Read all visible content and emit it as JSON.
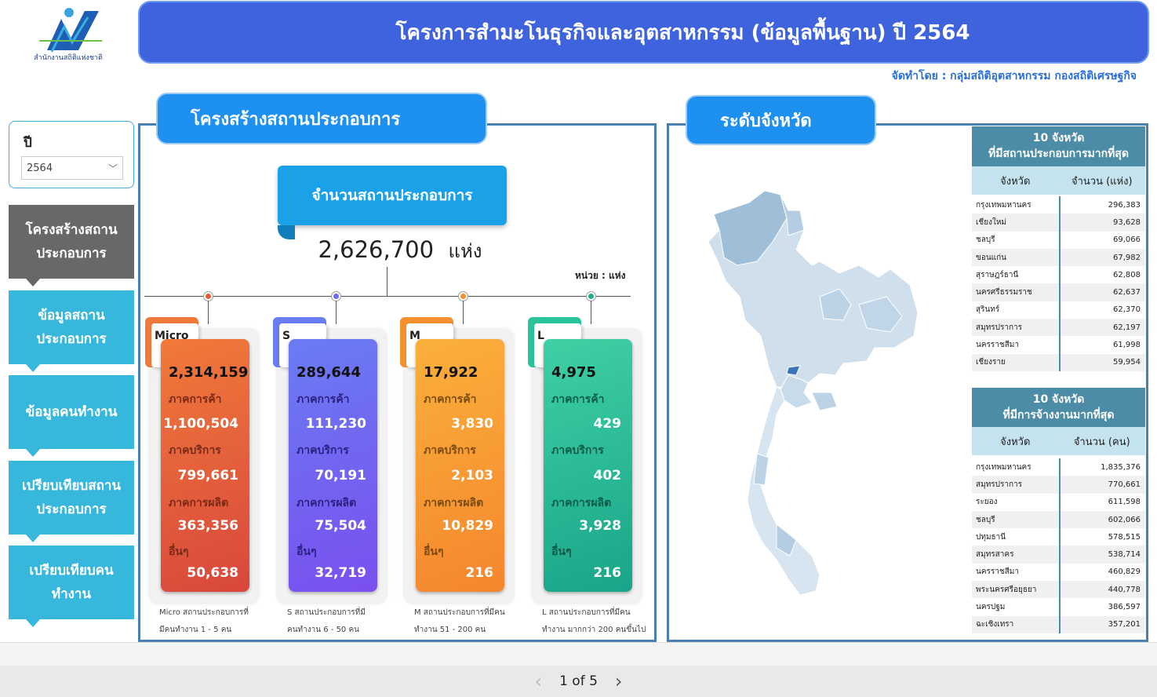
{
  "header": {
    "title": "โครงการสำมะโนธุรกิจและอุตสาหกรรม (ข้อมูลพื้นฐาน) ปี 2564",
    "credit": "จัดทำโดย : กลุ่มสถิติอุตสาหกรรม กองสถิติเศรษฐกิจ",
    "logo_text": "สำนักงานสถิติแห่งชาติ"
  },
  "filter": {
    "label": "ปี",
    "value": "2564"
  },
  "nav": [
    {
      "label": "โครงสร้างสถานประกอบการ",
      "active": true
    },
    {
      "label": "ข้อมูลสถานประกอบการ"
    },
    {
      "label": "ข้อมูลคนทำงาน"
    },
    {
      "label": "เปรียบเทียบสถานประกอบการ"
    },
    {
      "label": "เปรียบเทียบคนทำงาน"
    }
  ],
  "structure": {
    "title": "โครงสร้างสถานประกอบการ",
    "count_label": "จำนวนสถานประกอบการ",
    "total": "2,626,700",
    "total_unit": "แห่ง",
    "unit_note": "หน่วย : แห่ง",
    "sector_labels": {
      "trade": "ภาคการค้า",
      "service": "ภาคบริการ",
      "manufacturing": "ภาคการผลิต",
      "other": "อื่นๆ"
    },
    "cards": [
      {
        "tag": "Micro",
        "total": "2,314,159",
        "trade": "1,100,504",
        "service": "799,661",
        "manufacturing": "363,356",
        "other": "50,638",
        "note1": "Micro สถานประกอบการที่",
        "note2": "มีคนทำงาน 1 - 5 คน"
      },
      {
        "tag": "S",
        "total": "289,644",
        "trade": "111,230",
        "service": "70,191",
        "manufacturing": "75,504",
        "other": "32,719",
        "note1": "S สถานประกอบการที่มี",
        "note2": "คนทำงาน 6 - 50 คน"
      },
      {
        "tag": "M",
        "total": "17,922",
        "trade": "3,830",
        "service": "2,103",
        "manufacturing": "10,829",
        "other": "216",
        "note1": "M สถานประกอบการที่มีคน",
        "note2": "ทำงาน 51 - 200 คน"
      },
      {
        "tag": "L",
        "total": "4,975",
        "trade": "429",
        "service": "402",
        "manufacturing": "3,928",
        "other": "216",
        "note1": "L สถานประกอบการที่มีคน",
        "note2": "ทำงาน มากกว่า 200 คนขึ้นไป"
      }
    ]
  },
  "province": {
    "title": "ระดับจังหวัด",
    "top_establishments": {
      "title1": "10 จังหวัด",
      "title2": "ที่มีสถานประกอบการมากที่สุด",
      "col1": "จังหวัด",
      "col2": "จำนวน (แห่ง)",
      "rows": [
        [
          "กรุงเทพมหานคร",
          "296,383"
        ],
        [
          "เชียงใหม่",
          "93,628"
        ],
        [
          "ชลบุรี",
          "69,066"
        ],
        [
          "ขอนแก่น",
          "67,982"
        ],
        [
          "สุราษฎร์ธานี",
          "62,808"
        ],
        [
          "นครศรีธรรมราช",
          "62,637"
        ],
        [
          "สุรินทร์",
          "62,370"
        ],
        [
          "สมุทรปราการ",
          "62,197"
        ],
        [
          "นครราชสีมา",
          "61,998"
        ],
        [
          "เชียงราย",
          "59,954"
        ]
      ]
    },
    "top_employment": {
      "title1": "10 จังหวัด",
      "title2": "ที่มีการจ้างงานมากที่สุด",
      "col1": "จังหวัด",
      "col2": "จำนวน (คน)",
      "rows": [
        [
          "กรุงเทพมหานคร",
          "1,835,376"
        ],
        [
          "สมุทรปราการ",
          "770,661"
        ],
        [
          "ระยอง",
          "611,598"
        ],
        [
          "ชลบุรี",
          "602,066"
        ],
        [
          "ปทุมธานี",
          "578,515"
        ],
        [
          "สมุทรสาคร",
          "538,714"
        ],
        [
          "นครราชสีมา",
          "460,829"
        ],
        [
          "พระนครศรีอยุธยา",
          "440,778"
        ],
        [
          "นครปฐม",
          "386,597"
        ],
        [
          "ฉะเชิงเทรา",
          "357,201"
        ]
      ]
    }
  },
  "pager": {
    "label": "1 of 5"
  },
  "colors": {
    "micro": [
      "#f07a3a",
      "#d9473c"
    ],
    "s": [
      "#6a7cf2",
      "#7a4ff0"
    ],
    "m": [
      "#fbb03b",
      "#f4862e"
    ],
    "l": [
      "#3fd0a5",
      "#18a589"
    ]
  }
}
